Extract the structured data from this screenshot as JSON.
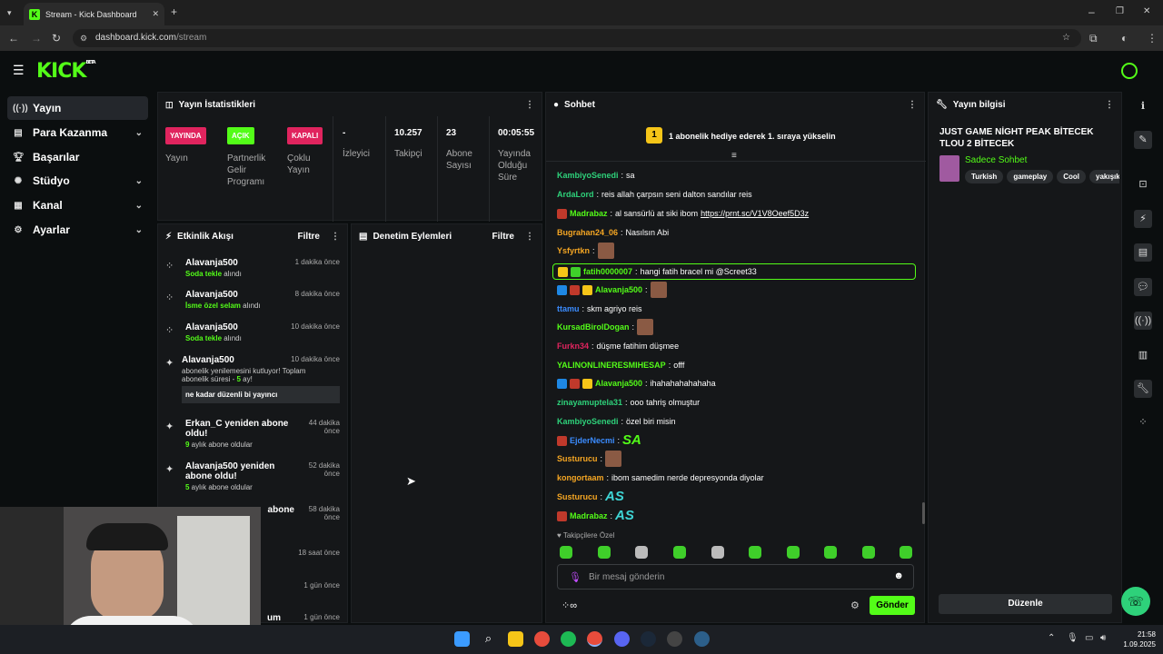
{
  "browser": {
    "tab_title": "Stream - Kick Dashboard",
    "url_domain": "dashboard.kick.com",
    "url_path": "/stream"
  },
  "logo": "KICK",
  "logo_beta": "BETA",
  "sidebar": {
    "items": [
      {
        "label": "Yayın",
        "icon": "broadcast-icon"
      },
      {
        "label": "Para Kazanma",
        "icon": "money-icon"
      },
      {
        "label": "Başarılar",
        "icon": "trophy-icon"
      },
      {
        "label": "Stüdyo",
        "icon": "settings-icon"
      },
      {
        "label": "Kanal",
        "icon": "channel-icon"
      },
      {
        "label": "Ayarlar",
        "icon": "gear-icon"
      }
    ]
  },
  "stats": {
    "title": "Yayın İstatistikleri",
    "stream_status": "YAYINDA",
    "stream_label": "Yayın",
    "partner_status": "AÇIK",
    "partner_label": "Partnerlik Gelir Programı",
    "multi_status": "KAPALI",
    "multi_label": "Çoklu Yayın",
    "viewers": "-",
    "viewers_label": "İzleyici",
    "followers": "10.257",
    "followers_label": "Takipçi",
    "subs": "23",
    "subs_label": "Abone Sayısı",
    "uptime": "00:05:55",
    "uptime_label": "Yayında Olduğu Süre"
  },
  "activity": {
    "title": "Etkinlik Akışı",
    "filter": "Filtre",
    "items": [
      {
        "user": "Alavanja500",
        "action": "Soda tekle",
        "suffix": " alındı",
        "time": "1 dakika önce"
      },
      {
        "user": "Alavanja500",
        "action": "İsme özel selam",
        "suffix": " alındı",
        "time": "8 dakika önce"
      },
      {
        "user": "Alavanja500",
        "action": "Soda tekle",
        "suffix": " alındı",
        "time": "10 dakika önce"
      },
      {
        "user": "Alavanja500",
        "text": "abonelik yenilemesini kutluyor! Toplam abonelik süresi - ",
        "count": "5",
        "suffix": " ay!",
        "quote": "ne kadar düzenli bi yayıncı",
        "time": "10 dakika önce"
      },
      {
        "user": "Erkan_C yeniden abone oldu!",
        "count": "9",
        "suffix": " aylık abone oldular",
        "time": "44 dakika önce"
      },
      {
        "user": "Alavanja500 yeniden abone oldu!",
        "count": "5",
        "suffix": " aylık abone oldular",
        "time": "52 dakika önce"
      },
      {
        "user": "abone",
        "time": "58 dakika önce"
      },
      {
        "time": "18 saat önce"
      },
      {
        "time": "1 gün önce"
      },
      {
        "user": "um",
        "time": "1 gün önce"
      }
    ]
  },
  "moderation": {
    "title": "Denetim Eylemleri",
    "filter": "Filtre"
  },
  "chat": {
    "title": "Sohbet",
    "pinned_rank": "1",
    "pinned_text": "1 abonelik hediye ederek 1. sıraya yükselin",
    "messages": [
      {
        "user": "KambiyoSenedi",
        "color": "#2ed17a",
        "text": "sa"
      },
      {
        "user": "ArdaLord",
        "color": "#2ed17a",
        "text": "reis allah çarpsın seni dalton sandılar reis"
      },
      {
        "user": "Madrabaz",
        "color": "#53fc18",
        "text": "al sansürlü at siki ibom ",
        "link": "https://prnt.sc/V1V8Oeef5D3z"
      },
      {
        "user": "Bugrahan24_06",
        "color": "#f5a623",
        "text": "Nasılsın Abi"
      },
      {
        "user": "Ysfyrtkn",
        "color": "#f5a623",
        "text": ""
      },
      {
        "user": "fatih0000007",
        "color": "#53fc18",
        "text": "hangi fatih bracel mi @Screet33"
      },
      {
        "user": "Alavanja500",
        "color": "#53fc18",
        "text": ""
      },
      {
        "user": "ttamu",
        "color": "#3b8cff",
        "text": "skm agriyo reis"
      },
      {
        "user": "KursadBirolDogan",
        "color": "#53fc18",
        "text": ""
      },
      {
        "user": "Furkn34",
        "color": "#e0245e",
        "text": "düşme fatihim düşmee"
      },
      {
        "user": "YALINONLINERESMIHESAP",
        "color": "#53fc18",
        "text": "offf"
      },
      {
        "user": "Alavanja500",
        "color": "#53fc18",
        "text": "ihahahahahahaha"
      },
      {
        "user": "zinayamuptela31",
        "color": "#2ed17a",
        "text": "ooo tahriş olmuştur"
      },
      {
        "user": "KambiyoSenedi",
        "color": "#2ed17a",
        "text": "özel biri misin"
      },
      {
        "user": "EjderNecmi",
        "color": "#3b8cff",
        "text": "",
        "emote": "SA"
      },
      {
        "user": "Susturucu",
        "color": "#f5a623",
        "text": ""
      },
      {
        "user": "kongortaam",
        "color": "#f5a623",
        "text": "ibom samedim nerde depresyonda diyolar"
      },
      {
        "user": "Susturucu",
        "color": "#f5a623",
        "text": "",
        "emote": "AS"
      },
      {
        "user": "Madrabaz",
        "color": "#53fc18",
        "text": "",
        "emote": "AS"
      }
    ],
    "followers_only": "Takipçilere Özel",
    "placeholder": "Bir mesaj gönderin",
    "send": "Gönder"
  },
  "info": {
    "title": "Yayın bilgisi",
    "stream_title": "JUST GAME NİGHT PEAK BİTECEK TLOU 2 BİTECEK",
    "category": "Sadece Sohbet",
    "tags": [
      "Turkish",
      "gameplay",
      "Cool",
      "yakışık"
    ],
    "edit": "Düzenle"
  },
  "taskbar": {
    "time": "21:58",
    "date": "1.09.2025"
  }
}
